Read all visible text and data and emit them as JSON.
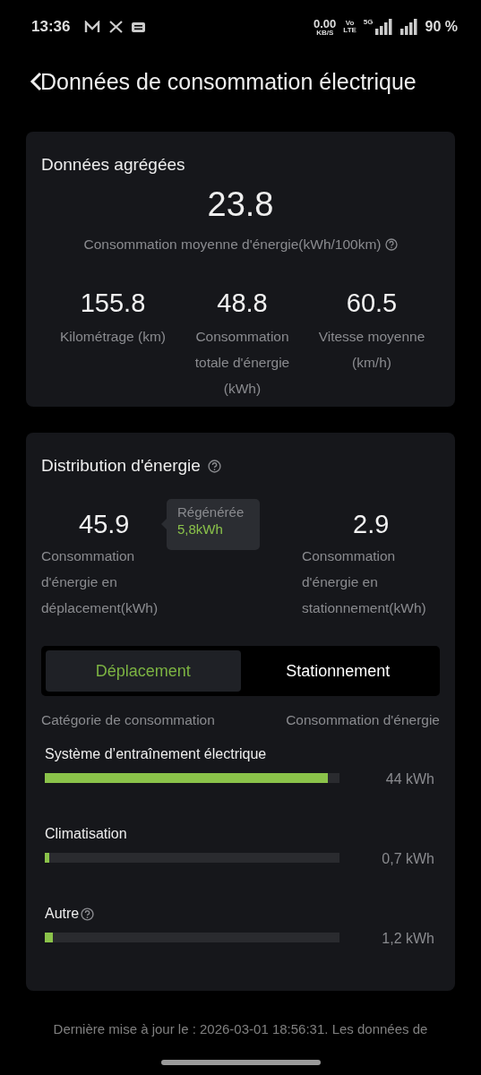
{
  "status_bar": {
    "time": "13:36",
    "speed_value": "0.00",
    "speed_unit": "KB/S",
    "volte_top": "Vo",
    "volte_bottom": "LTE",
    "network": "5G",
    "battery": "90 %"
  },
  "header": {
    "title": "Données de consommation électrique"
  },
  "aggregate": {
    "title": "Données agrégées",
    "main_value": "23.8",
    "main_label": "Consommation moyenne d'énergie(kWh/100km)",
    "stats": [
      {
        "value": "155.8",
        "label": "Kilométrage (km)"
      },
      {
        "value": "48.8",
        "label": "Consommation totale d'énergie (kWh)"
      },
      {
        "value": "60.5",
        "label": "Vitesse moyenne (km/h)"
      }
    ]
  },
  "distribution": {
    "title": "Distribution d'énergie",
    "driving": {
      "value": "45.9",
      "label": "Consommation d'énergie en déplacement(kWh)"
    },
    "regen": {
      "label": "Régénérée",
      "value": "5,8kWh"
    },
    "parking": {
      "value": "2.9",
      "label": "Consommation d'énergie en stationnement(kWh)"
    },
    "tabs": [
      {
        "label": "Déplacement",
        "selected": true
      },
      {
        "label": "Stationnement",
        "selected": false
      }
    ],
    "columns": [
      "Catégorie de consommation",
      "Consommation d'énergie"
    ],
    "categories": [
      {
        "name": "Système d’entraînement électrique",
        "help": false,
        "level": 0.96,
        "reading": "44 kWh"
      },
      {
        "name": "Climatisation",
        "help": false,
        "level": 0.015,
        "reading": "0,7 kWh"
      },
      {
        "name": "Autre",
        "help": true,
        "level": 0.026,
        "reading": "1,2 kWh"
      }
    ]
  },
  "footer": {
    "text": "Dernière mise à jour le : 2026-03-01 18:56:31. Les données de"
  }
}
